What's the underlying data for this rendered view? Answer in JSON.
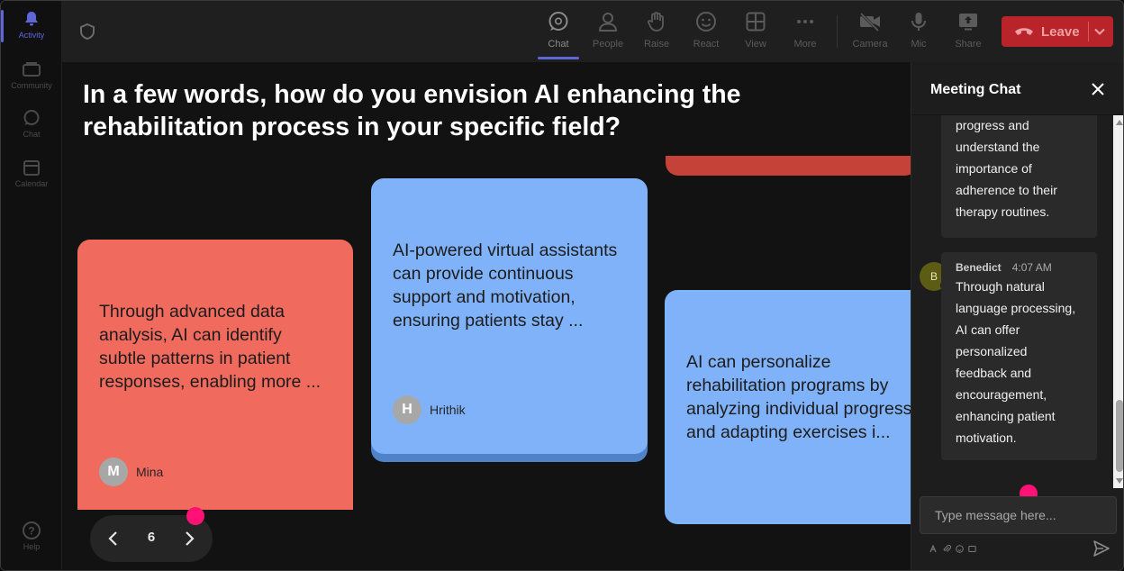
{
  "rail": {
    "items": [
      {
        "label": "Activity",
        "icon": "bell-icon",
        "active": true
      },
      {
        "label": "Community",
        "icon": "community-icon",
        "active": false
      },
      {
        "label": "Chat",
        "icon": "chat-icon",
        "active": false
      },
      {
        "label": "Calendar",
        "icon": "calendar-icon",
        "active": false
      }
    ],
    "help_label": "Help"
  },
  "toolbar": {
    "buttons": [
      {
        "label": "Chat",
        "icon": "chat-icon",
        "active": true
      },
      {
        "label": "People",
        "icon": "people-icon",
        "active": false
      },
      {
        "label": "Raise",
        "icon": "raise-hand-icon",
        "active": false
      },
      {
        "label": "React",
        "icon": "react-icon",
        "active": false
      },
      {
        "label": "View",
        "icon": "view-icon",
        "active": false
      },
      {
        "label": "More",
        "icon": "more-icon",
        "active": false
      },
      {
        "label": "Camera",
        "icon": "camera-off-icon",
        "active": false
      },
      {
        "label": "Mic",
        "icon": "mic-icon",
        "active": false
      },
      {
        "label": "Share",
        "icon": "share-icon",
        "active": false
      }
    ],
    "leave_label": "Leave",
    "colors": {
      "leave": "#b8242a",
      "accent": "#5e67d8"
    }
  },
  "stage": {
    "question": "In a few words, how do you envision AI enhancing the rehabilitation process in your specific field?",
    "cards": [
      {
        "text": "Through advanced data analysis, AI can identify subtle patterns in patient responses, enabling more ...",
        "author": "Mina",
        "initial": "M",
        "color": "#f06a5e"
      },
      {
        "text": "AI-powered virtual assistants can provide continuous support and motivation, ensuring patients stay ...",
        "author": "Hrithik",
        "initial": "H",
        "color": "#80b2f9"
      },
      {
        "text": "AI can personalize rehabilitation programs by analyzing individual progress and adapting exercises i...",
        "color": "#80b2f9"
      }
    ],
    "page_number": "6"
  },
  "chat": {
    "title": "Meeting Chat",
    "messages": [
      {
        "lines": [
          "progress and",
          "understand the",
          "importance of",
          "adherence to their",
          "therapy routines."
        ]
      },
      {
        "author": "Benedict",
        "initial": "B",
        "time": "4:07 AM",
        "lines": [
          "Through natural",
          "language processing,",
          "AI can offer",
          "personalized",
          "feedback and",
          "encouragement,",
          "enhancing patient",
          "motivation."
        ]
      }
    ],
    "compose_placeholder": "Type message here..."
  }
}
